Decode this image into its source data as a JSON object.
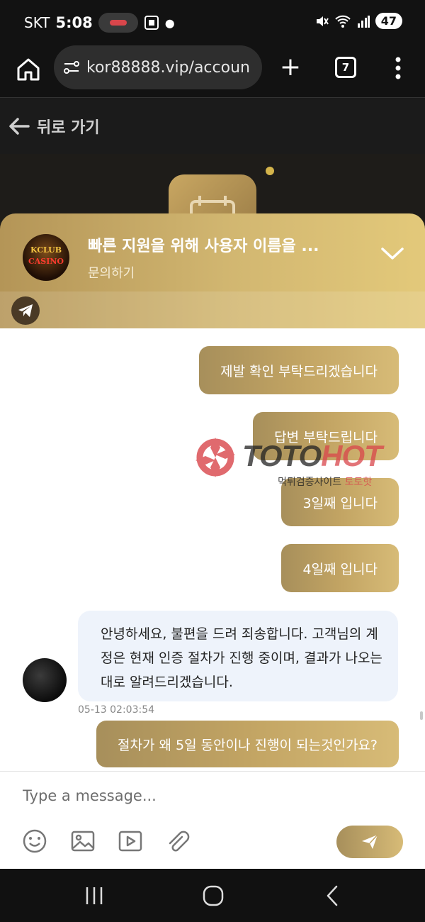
{
  "status_bar": {
    "carrier": "SKT",
    "time": "5:08",
    "battery": "47"
  },
  "browser": {
    "url": "kor88888.vip/accoun",
    "tab_count": "7"
  },
  "page": {
    "back_label": "뒤로 가기"
  },
  "chat_header": {
    "logo_text_top": "KCLUB",
    "logo_text_bottom": "CASINO",
    "title": "빠른 지원을 위해 사용자 이름을 ...",
    "subtitle": "문의하기"
  },
  "messages": [
    {
      "direction": "out",
      "text": "제발 확인 부탁드리겠습니다"
    },
    {
      "direction": "out",
      "text": "답변 부탁드립니다"
    },
    {
      "direction": "out",
      "text": "3일째 입니다"
    },
    {
      "direction": "out",
      "text": "4일째 입니다"
    },
    {
      "direction": "in",
      "text": "안녕하세요, 불편을 드려 죄송합니다. 고객님의 계정은 현재 인증 절차가 진행 중이며, 결과가 나오는 대로 알려드리겠습니다.",
      "timestamp": "05-13 02:03:54"
    },
    {
      "direction": "out",
      "text": "절차가 왜 5일 동안이나 진행이 되는것인가요?"
    }
  ],
  "watermark": {
    "brand_a": "TOTO",
    "brand_b": "HOT",
    "sub_a": "먹튀검증사이트 ",
    "sub_b": "토토핫"
  },
  "composer": {
    "placeholder": "Type a message..."
  },
  "icons": [
    "home-icon",
    "site-settings-icon",
    "plus-icon",
    "tabs-icon",
    "more-icon",
    "back-arrow-icon",
    "chevron-down-icon",
    "telegram-icon",
    "emoji-icon",
    "image-icon",
    "video-icon",
    "attachment-icon",
    "send-icon",
    "recents-icon",
    "home-nav-icon",
    "back-nav-icon"
  ],
  "colors": {
    "gold_start": "#a78f5b",
    "gold_end": "#d7bb77",
    "incoming_bubble": "#eef3fb",
    "watermark_red": "#d9464b"
  }
}
